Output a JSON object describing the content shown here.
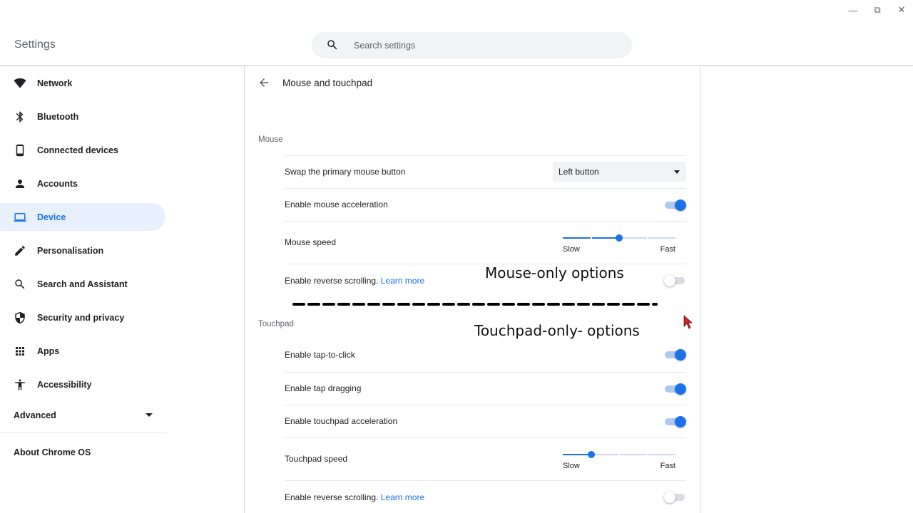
{
  "window": {
    "minimize_glyph": "—",
    "maximize_glyph": "⧉",
    "close_glyph": "✕"
  },
  "header": {
    "title": "Settings",
    "search": {
      "placeholder": "Search settings",
      "value": ""
    }
  },
  "sidebar": {
    "items": [
      {
        "label": "Network",
        "icon": "wifi-icon"
      },
      {
        "label": "Bluetooth",
        "icon": "bluetooth-icon"
      },
      {
        "label": "Connected devices",
        "icon": "phone-icon"
      },
      {
        "label": "Accounts",
        "icon": "person-icon"
      },
      {
        "label": "Device",
        "icon": "laptop-icon",
        "active": true
      },
      {
        "label": "Personalisation",
        "icon": "pen-icon"
      },
      {
        "label": "Search and Assistant",
        "icon": "search-icon"
      },
      {
        "label": "Security and privacy",
        "icon": "shield-icon"
      },
      {
        "label": "Apps",
        "icon": "apps-grid-icon"
      },
      {
        "label": "Accessibility",
        "icon": "accessibility-icon"
      }
    ],
    "advanced_label": "Advanced",
    "about_label": "About Chrome OS"
  },
  "main": {
    "title": "Mouse and touchpad",
    "mouse": {
      "section_label": "Mouse",
      "swap_label": "Swap the primary mouse button",
      "swap_value": "Left button",
      "acceleration_label": "Enable mouse acceleration",
      "acceleration_on": true,
      "speed_label": "Mouse speed",
      "speed_fraction": 0.5,
      "speed_min_label": "Slow",
      "speed_max_label": "Fast",
      "reverse_label": "Enable reverse scrolling.",
      "reverse_link": "Learn more",
      "reverse_on": false
    },
    "touchpad": {
      "section_label": "Touchpad",
      "tap_click_label": "Enable tap-to-click",
      "tap_click_on": true,
      "tap_drag_label": "Enable tap dragging",
      "tap_drag_on": true,
      "acceleration_label": "Enable touchpad acceleration",
      "acceleration_on": true,
      "speed_label": "Touchpad speed",
      "speed_fraction": 0.25,
      "speed_min_label": "Slow",
      "speed_max_label": "Fast",
      "reverse_label": "Enable reverse scrolling.",
      "reverse_link": "Learn more",
      "reverse_on": false
    }
  },
  "annotations": {
    "mouse_only": "Mouse-only options",
    "touchpad_only": "Touchpad-only- options"
  },
  "colors": {
    "accent": "#1a73e8",
    "active_bg": "#e8f0fe",
    "annotation_cursor": "#c62828"
  }
}
